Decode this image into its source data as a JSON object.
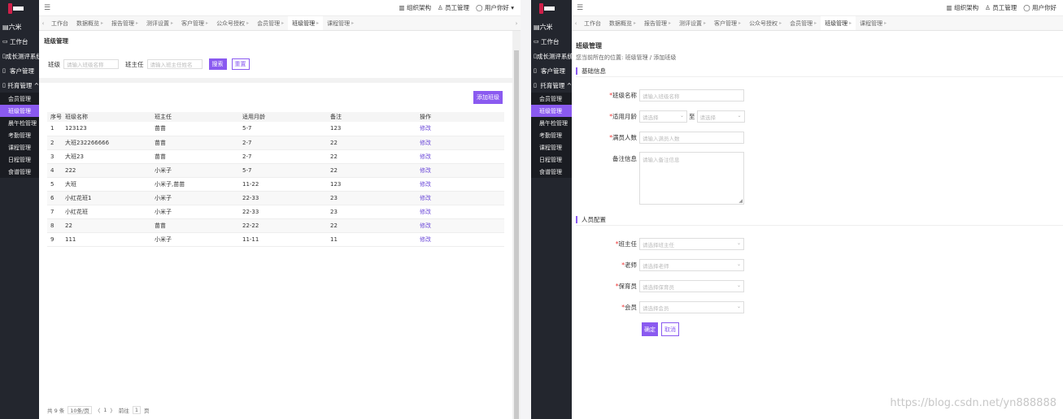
{
  "accent_color": "#8a5af0",
  "left": {
    "sidebar": {
      "org": "六米",
      "items": [
        {
          "label": "工作台",
          "icon": "monitor-icon"
        },
        {
          "label": "成长测评系统",
          "icon": "file-icon"
        },
        {
          "label": "客户管理",
          "icon": "file-icon"
        },
        {
          "label": "托育管理 ^",
          "icon": "file-icon"
        }
      ],
      "subs": [
        "会员管理",
        "班级管理",
        "晨午检管理",
        "考勤管理",
        "课程管理",
        "日程管理",
        "食谱管理"
      ]
    },
    "topbar": {
      "org_chart": "组织架构",
      "staff": "员工管理",
      "user": "用户你好 ▾"
    },
    "tabs": [
      "工作台",
      "数据概览",
      "报告管理",
      "测评设置",
      "客户管理",
      "公众号授权",
      "会员管理",
      "班级管理",
      "课程管理"
    ],
    "page_title": "班级管理",
    "search": {
      "class_label": "班级",
      "class_placeholder": "请输入班级名称",
      "teacher_label": "班主任",
      "teacher_placeholder": "请输入班主任姓名",
      "search_btn": "搜索",
      "reset_btn": "重置"
    },
    "add_btn": "添加班级",
    "table": {
      "headers": [
        "序号",
        "班级名称",
        "班主任",
        "适用月龄",
        "备注",
        "操作"
      ],
      "rows": [
        [
          "1",
          "123123",
          "苗苗",
          "5-7",
          "123",
          "修改"
        ],
        [
          "2",
          "大班232266666",
          "苗苗",
          "2-7",
          "22",
          "修改"
        ],
        [
          "3",
          "大班23",
          "苗苗",
          "2-7",
          "22",
          "修改"
        ],
        [
          "4",
          "222",
          "小米子",
          "5-7",
          "22",
          "修改"
        ],
        [
          "5",
          "大班",
          "小米子,苗苗",
          "11-22",
          "123",
          "修改"
        ],
        [
          "6",
          "小红花班1",
          "小米子",
          "22-33",
          "23",
          "修改"
        ],
        [
          "7",
          "小红花班",
          "小米子",
          "22-33",
          "23",
          "修改"
        ],
        [
          "8",
          "22",
          "苗苗",
          "22-22",
          "22",
          "修改"
        ],
        [
          "9",
          "111",
          "小米子",
          "11-11",
          "11",
          "修改"
        ]
      ]
    },
    "pager": {
      "total": "共 9 条",
      "size": "10条/页",
      "prev": "〈",
      "page": "1",
      "next": "〉",
      "goto": "前往",
      "goto_page": "1",
      "unit": "页"
    }
  },
  "right": {
    "sidebar": {
      "org": "六米",
      "items": [
        {
          "label": "工作台",
          "icon": "monitor-icon"
        },
        {
          "label": "成长测评系统",
          "icon": "file-icon"
        },
        {
          "label": "客户管理",
          "icon": "file-icon"
        },
        {
          "label": "托育管理 ^",
          "icon": "file-icon"
        }
      ],
      "subs": [
        "会员管理",
        "班级管理",
        "晨午检管理",
        "考勤管理",
        "课程管理",
        "日程管理",
        "食谱管理"
      ]
    },
    "topbar": {
      "org_chart": "组织架构",
      "staff": "员工管理",
      "user": "用户你好"
    },
    "tabs": [
      "工作台",
      "数据概览",
      "报告管理",
      "测评设置",
      "客户管理",
      "公众号授权",
      "会员管理",
      "班级管理",
      "课程管理"
    ],
    "page_title": "班级管理",
    "crumb": "您当前所在的位置: 班级管理 / 添加班级",
    "basic_title": "基础信息",
    "fields": {
      "name_label": "班级名称",
      "name_ph": "请输入班级名称",
      "age_label": "适用月龄",
      "age_from_ph": "请选择",
      "age_to": "至",
      "age_to_ph": "请选择",
      "cap_label": "满员人数",
      "cap_ph": "请输入满员人数",
      "note_label": "备注信息",
      "note_ph": "请输入备注信息"
    },
    "staff_title": "人员配置",
    "staff": {
      "head_label": "班主任",
      "head_ph": "请选择班主任",
      "teacher_label": "老师",
      "teacher_ph": "请选择老师",
      "nurse_label": "保育员",
      "nurse_ph": "请选择保育员",
      "member_label": "会员",
      "member_ph": "请选择会员"
    },
    "ok_btn": "确定",
    "cancel_btn": "取消",
    "watermark": "https://blog.csdn.net/yn888888"
  }
}
